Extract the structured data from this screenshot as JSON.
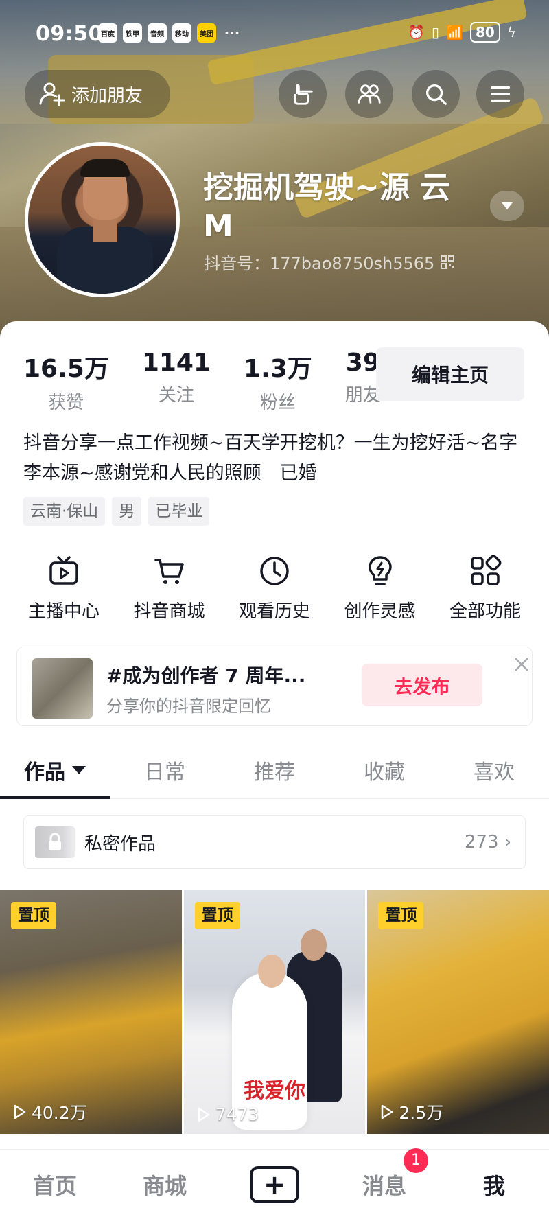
{
  "status_bar": {
    "time": "09:50",
    "app_icons": [
      "百度",
      "铁甲",
      "音频",
      "移动",
      "美团",
      "···"
    ],
    "battery": "80"
  },
  "header": {
    "add_friend_label": "添加朋友",
    "icons": [
      "hand-pointer-icon",
      "friends-icon",
      "search-icon",
      "menu-icon"
    ]
  },
  "profile": {
    "name": "挖掘机驾驶~源 云M",
    "douyin_id": "抖音号：177bao8750sh5565"
  },
  "stats": [
    {
      "value": "16.5万",
      "label": "获赞"
    },
    {
      "value": "1141",
      "label": "关注"
    },
    {
      "value": "1.3万",
      "label": "粉丝"
    },
    {
      "value": "39",
      "label": "朋友"
    }
  ],
  "edit_profile_label": "编辑主页",
  "bio": "抖音分享一点工作视频~百天学开挖机？一生为挖好活~名字李本源~感谢党和人民的照顾　已婚",
  "tags": [
    "云南·保山",
    "男",
    "已毕业"
  ],
  "tools": [
    {
      "label": "主播中心",
      "icon": "tv-play-icon"
    },
    {
      "label": "抖音商城",
      "icon": "cart-icon"
    },
    {
      "label": "观看历史",
      "icon": "clock-icon"
    },
    {
      "label": "创作灵感",
      "icon": "lightbulb-icon"
    },
    {
      "label": "全部功能",
      "icon": "grid-icon"
    }
  ],
  "promo": {
    "title": "#成为创作者 7 周年...",
    "subtitle": "分享你的抖音限定回忆",
    "action_label": "去发布"
  },
  "content_tabs": [
    "作品",
    "日常",
    "推荐",
    "收藏",
    "喜欢"
  ],
  "active_tab": "作品",
  "private_works": {
    "label": "私密作品",
    "count": "273"
  },
  "videos": [
    {
      "pinned_label": "置顶",
      "plays": "40.2万"
    },
    {
      "pinned_label": "置顶",
      "plays": "7473",
      "caption": "我爱你"
    },
    {
      "pinned_label": "置顶",
      "plays": "2.5万"
    }
  ],
  "bottom_nav": [
    {
      "label": "首页"
    },
    {
      "label": "商城"
    },
    {
      "label": "+"
    },
    {
      "label": "消息",
      "badge": "1"
    },
    {
      "label": "我"
    }
  ],
  "colors": {
    "accent": "#fe2c55",
    "pin": "#ffd02b",
    "text": "#161823",
    "muted": "#8a8b91"
  }
}
